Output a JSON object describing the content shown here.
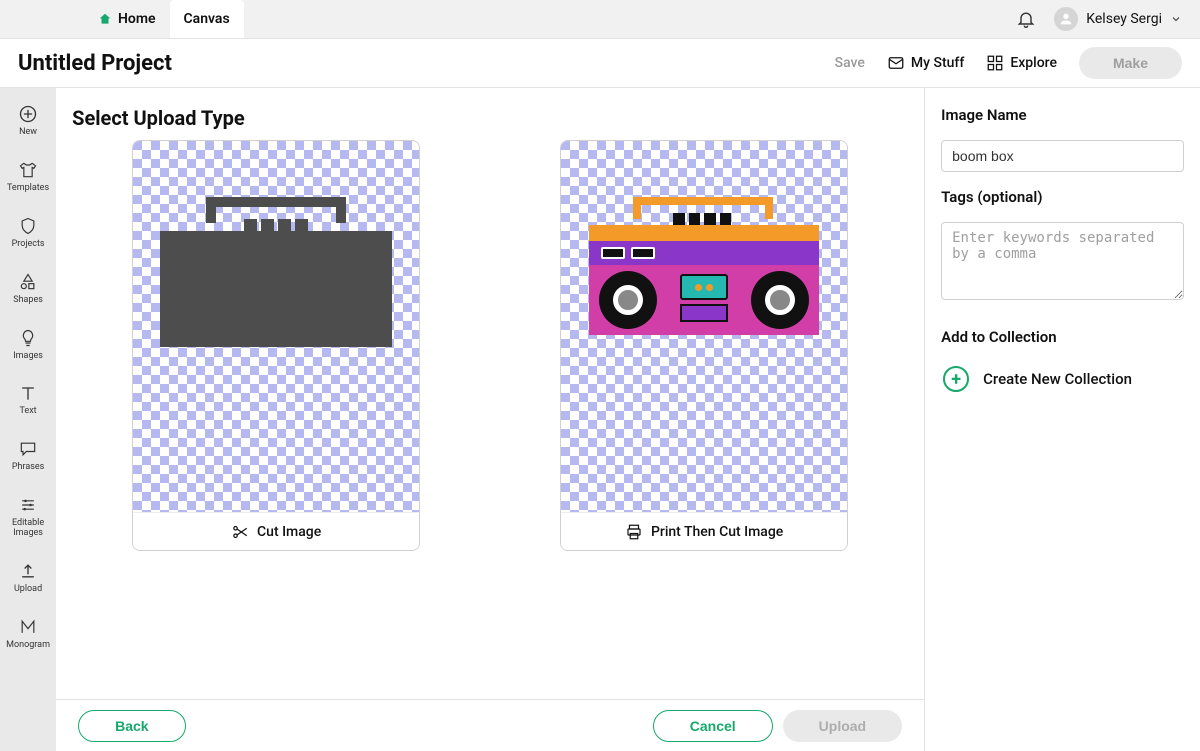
{
  "topnav": {
    "tabs": [
      {
        "label": "Home"
      },
      {
        "label": "Canvas"
      }
    ],
    "user_name": "Kelsey Sergi"
  },
  "header": {
    "project_title": "Untitled Project",
    "save_label": "Save",
    "mystuff_label": "My Stuff",
    "explore_label": "Explore",
    "make_label": "Make"
  },
  "leftbar": {
    "items": [
      {
        "label": "New"
      },
      {
        "label": "Templates"
      },
      {
        "label": "Projects"
      },
      {
        "label": "Shapes"
      },
      {
        "label": "Images"
      },
      {
        "label": "Text"
      },
      {
        "label": "Phrases"
      },
      {
        "label": "Editable Images"
      },
      {
        "label": "Upload"
      },
      {
        "label": "Monogram"
      }
    ]
  },
  "canvas": {
    "heading": "Select Upload Type",
    "options": [
      {
        "caption": "Cut Image"
      },
      {
        "caption": "Print Then Cut Image"
      }
    ]
  },
  "rightpanel": {
    "image_name_label": "Image Name",
    "image_name_value": "boom box",
    "tags_label": "Tags (optional)",
    "tags_placeholder": "Enter keywords separated by a comma",
    "collection_label": "Add to Collection",
    "create_collection_label": "Create New Collection"
  },
  "footer": {
    "back_label": "Back",
    "cancel_label": "Cancel",
    "upload_label": "Upload"
  }
}
